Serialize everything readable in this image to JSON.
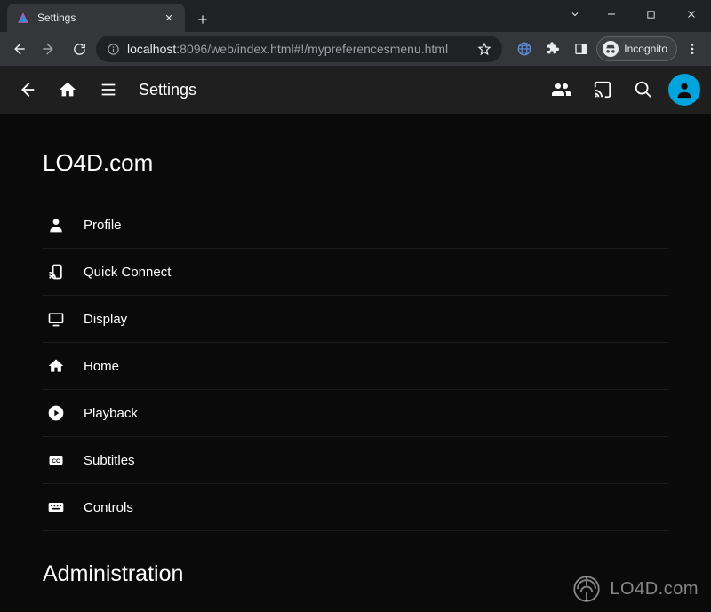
{
  "browser": {
    "tab_title": "Settings",
    "incognito_label": "Incognito",
    "url_host": "localhost",
    "url_path": ":8096/web/index.html#!/mypreferencesmenu.html"
  },
  "header": {
    "title": "Settings"
  },
  "section": {
    "user": "LO4D.com",
    "admin_heading": "Administration"
  },
  "menu": [
    {
      "icon": "person",
      "label": "Profile"
    },
    {
      "icon": "cast-connect",
      "label": "Quick Connect"
    },
    {
      "icon": "display",
      "label": "Display"
    },
    {
      "icon": "home",
      "label": "Home"
    },
    {
      "icon": "play",
      "label": "Playback"
    },
    {
      "icon": "cc",
      "label": "Subtitles"
    },
    {
      "icon": "keyboard",
      "label": "Controls"
    }
  ],
  "watermark": {
    "text": "LO4D.com"
  }
}
